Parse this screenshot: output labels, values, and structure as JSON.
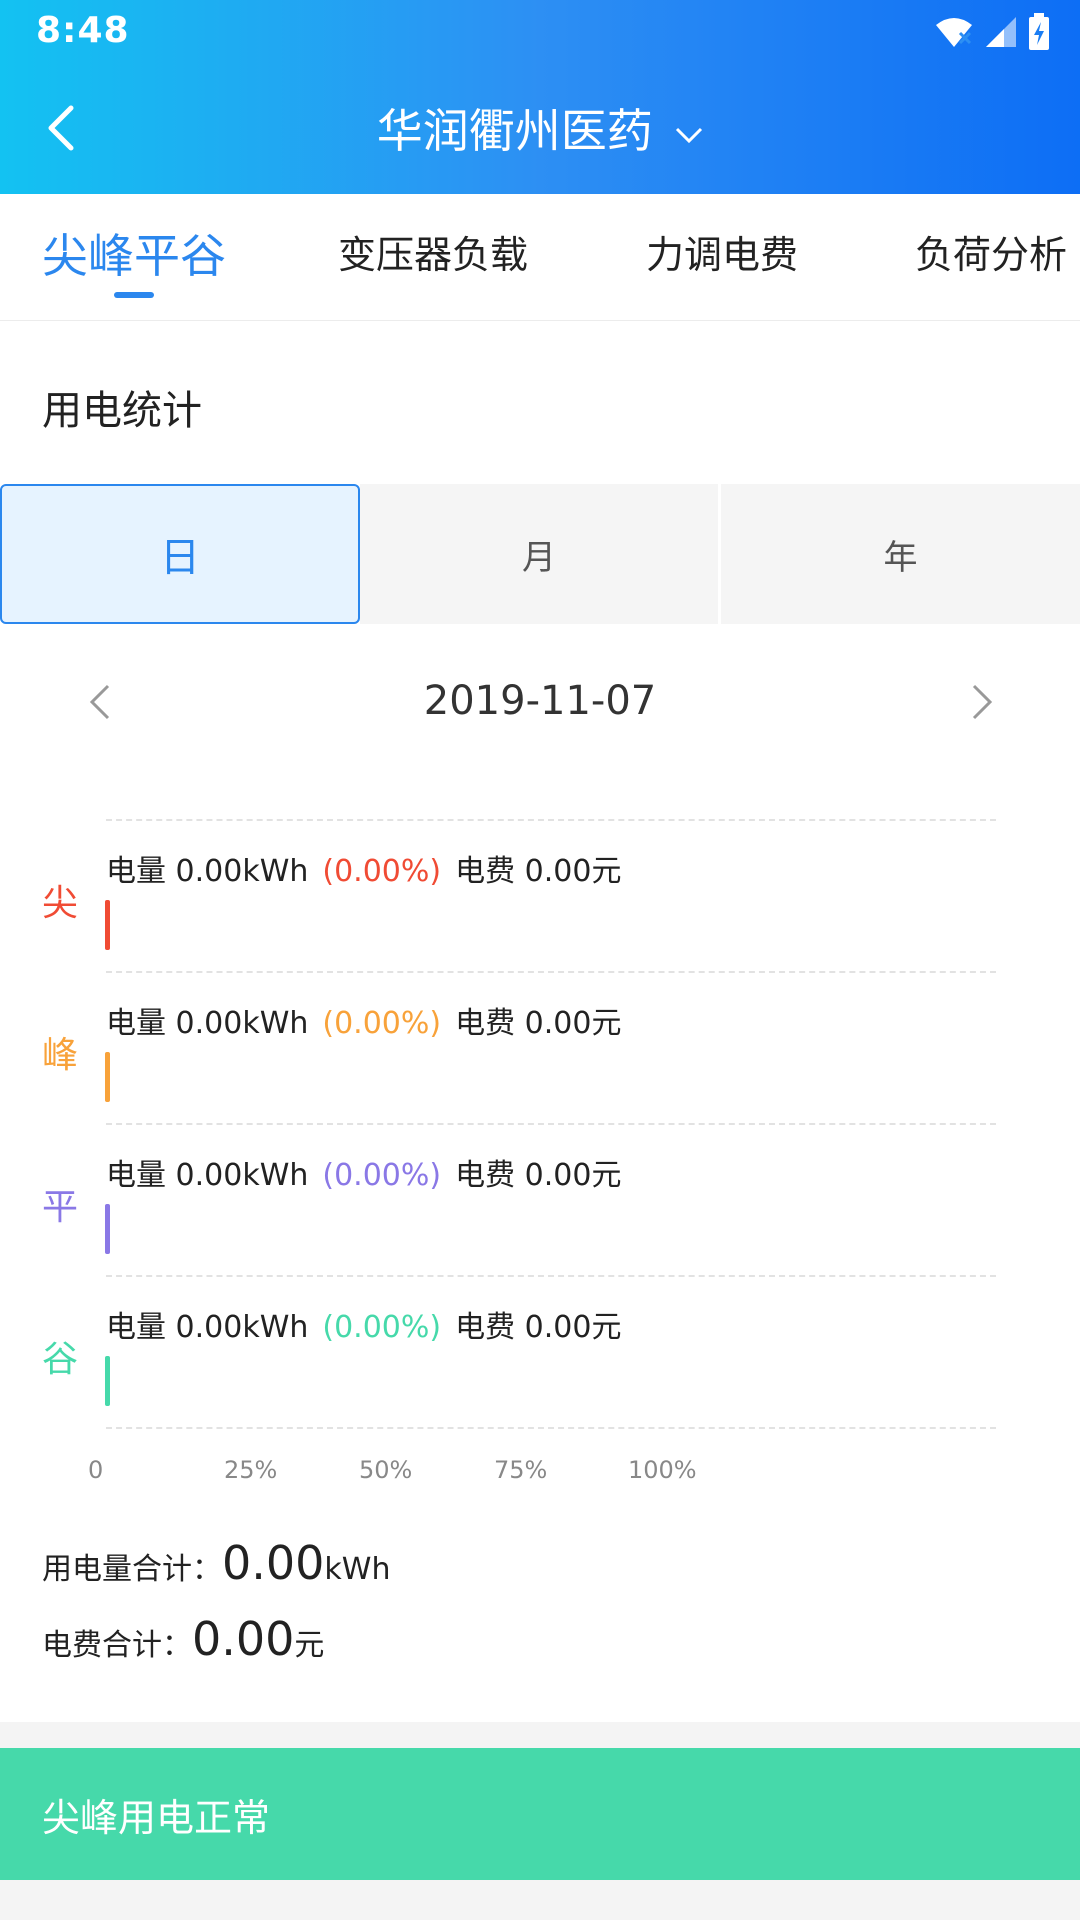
{
  "status_bar": {
    "time": "8:48"
  },
  "header": {
    "title": "华润衢州医药"
  },
  "tabs": [
    {
      "label": "尖峰平谷",
      "active": true
    },
    {
      "label": "变压器负载",
      "active": false
    },
    {
      "label": "力调电费",
      "active": false
    },
    {
      "label": "负荷分析",
      "active": false
    }
  ],
  "section": {
    "title": "用电统计"
  },
  "period_selector": [
    {
      "label": "日",
      "active": true
    },
    {
      "label": "月",
      "active": false
    },
    {
      "label": "年",
      "active": false
    }
  ],
  "date_nav": {
    "date": "2019-11-07"
  },
  "chart_data": {
    "type": "bar",
    "orientation": "horizontal",
    "categories": [
      "尖",
      "峰",
      "平",
      "谷"
    ],
    "values": [
      0.0,
      0.0,
      0.0,
      0.0
    ],
    "xlim": [
      0,
      100
    ],
    "x_ticks": [
      "0",
      "25%",
      "50%",
      "75%",
      "100%"
    ],
    "grid": true,
    "colors": [
      "#f04b34",
      "#f8a23a",
      "#8a78e6",
      "#46d9aa"
    ],
    "rows": [
      {
        "label": "尖",
        "energy_text": "电量 0.00kWh",
        "percent_text": "(0.00%)",
        "fee_text": "电费 0.00元",
        "color": "#f04b34"
      },
      {
        "label": "峰",
        "energy_text": "电量 0.00kWh",
        "percent_text": "(0.00%)",
        "fee_text": "电费 0.00元",
        "color": "#f8a23a"
      },
      {
        "label": "平",
        "energy_text": "电量 0.00kWh",
        "percent_text": "(0.00%)",
        "fee_text": "电费 0.00元",
        "color": "#8a78e6"
      },
      {
        "label": "谷",
        "energy_text": "电量 0.00kWh",
        "percent_text": "(0.00%)",
        "fee_text": "电费 0.00元",
        "color": "#46d9aa"
      }
    ]
  },
  "totals": {
    "energy_label": "用电量合计：",
    "energy_value": "0.00",
    "energy_unit": "kWh",
    "fee_label": "电费合计：",
    "fee_value": "0.00",
    "fee_unit": "元"
  },
  "banner": {
    "text": "尖峰用电正常",
    "color": "#46d9aa"
  },
  "colors": {
    "accent": "#2b87ee"
  }
}
